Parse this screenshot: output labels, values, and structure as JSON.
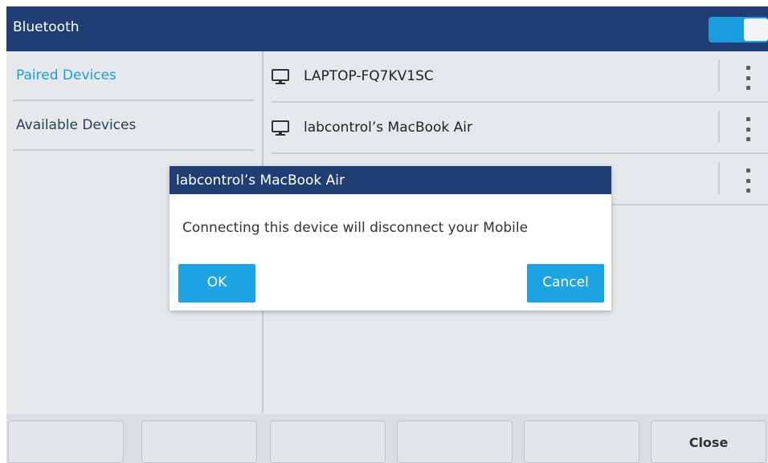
{
  "header": {
    "title": "Bluetooth",
    "toggle_on": true
  },
  "sidebar": {
    "items": [
      {
        "label": "Paired Devices",
        "selected": true
      },
      {
        "label": "Available Devices",
        "selected": false
      }
    ]
  },
  "devices": [
    {
      "name": "LAPTOP-FQ7KV1SC",
      "icon": "monitor-icon"
    },
    {
      "name": "labcontrol’s MacBook Air",
      "icon": "monitor-icon"
    },
    {
      "name": "",
      "icon": "monitor-icon"
    }
  ],
  "dialog": {
    "title": "labcontrol’s MacBook Air",
    "message": "Connecting this device will disconnect your Mobile",
    "ok_label": "OK",
    "cancel_label": "Cancel"
  },
  "softkeys": [
    "",
    "",
    "",
    "",
    "",
    "Close"
  ],
  "colors": {
    "header": "#1f3f74",
    "accent": "#1ea4e4",
    "selected_text": "#1b9be0",
    "background": "#e6e9ec"
  }
}
